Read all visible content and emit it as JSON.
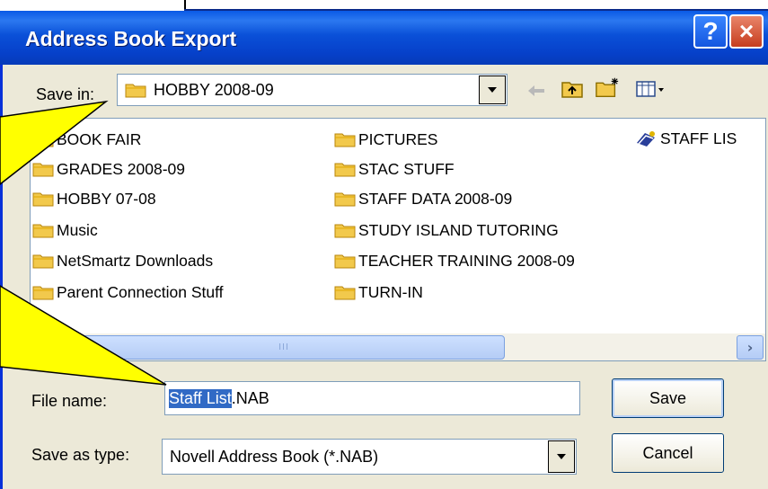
{
  "window": {
    "title": "Address Book Export",
    "help_label": "?",
    "close_label": "×"
  },
  "save_in": {
    "label": "Save in:",
    "value": "HOBBY 2008-09"
  },
  "toolbar": {
    "icons": [
      "back-arrow-icon",
      "up-folder-icon",
      "new-folder-icon",
      "views-menu-icon"
    ]
  },
  "files": {
    "col1": [
      "BOOK FAIR",
      "GRADES 2008-09",
      "HOBBY 07-08",
      "Music",
      "NetSmartz Downloads",
      "Parent Connection Stuff"
    ],
    "col2": [
      "PICTURES",
      "STAC STUFF",
      "STAFF DATA 2008-09",
      "STUDY ISLAND TUTORING",
      "TEACHER TRAINING 2008-09",
      "TURN-IN"
    ],
    "col3": [
      "STAFF LIS"
    ]
  },
  "scrollbar": {
    "thumb_grip": "III",
    "right_arrow": "›"
  },
  "file_name": {
    "label": "File name:",
    "selected": "Staff List",
    "rest": ".NAB"
  },
  "save_as_type": {
    "label": "Save as type:",
    "value": "Novell Address Book (*.NAB)"
  },
  "buttons": {
    "save": "Save",
    "cancel": "Cancel"
  },
  "colors": {
    "titlebar": "#0a50d8",
    "callout": "#ffff00",
    "selection": "#316ac5",
    "folder": "#f2c94c"
  }
}
